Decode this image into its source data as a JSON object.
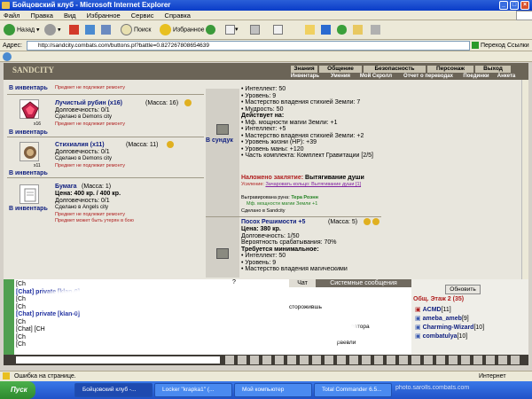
{
  "window": {
    "title": "Бойцовский клуб - Microsoft Internet Explorer"
  },
  "menu": [
    "Файл",
    "Правка",
    "Вид",
    "Избранное",
    "Сервис",
    "Справка"
  ],
  "toolbar": {
    "back": "Назад",
    "search": "Поиск",
    "favorites": "Избранное"
  },
  "address": {
    "label": "Адрес:",
    "url": "http://sandcity.combats.com/buttons.pl?battle=0.827267808654639",
    "go": "Переход",
    "links": "Ссылки"
  },
  "game": {
    "logo": "SANDCITY",
    "nav_top": [
      "Знания",
      "Общение",
      "Безопасность",
      "Персонаж",
      "Выход"
    ],
    "nav_bottom": [
      "Инвентарь",
      "Умения",
      "Мой Скролл",
      "Отчет о переводах",
      "Поединки",
      "Анкета"
    ]
  },
  "inventory": {
    "header_link": "В инвентарь",
    "header_note": "Предмет не подлежит ремонту",
    "items": [
      {
        "link": "В инвентарь",
        "name": "Лучистый рубин (x16)",
        "mass": "(Масса: 16)",
        "durability": "Долговечность: 0/1",
        "made": "Сделано в Demons city",
        "note": "Предмет не подлежит ремонту",
        "count": "x16"
      },
      {
        "link": "В инвентарь",
        "name": "Стихиалия (x11)",
        "mass": "(Масса: 11)",
        "durability": "Долговечность: 0/1",
        "made": "Сделано в Demons city",
        "note": "Предмет не подлежит ремонту",
        "count": "x11"
      },
      {
        "link": "В инвентарь",
        "name": "Бумага",
        "mass": "(Масса: 1)",
        "price": "Цена: 400 кр. / 400 кр.",
        "durability": "Долговечность: 0/1",
        "made": "Сделано в Angels city",
        "note": "Предмет не подлежит ремонту",
        "note2": "Предмет может быть утерян в бою"
      }
    ]
  },
  "chest": {
    "link": "В сундук",
    "item1": {
      "req": [
        "• Интеллект: 50",
        "• Уровень: 9",
        "• Мастерство владения стихией Земли: 7",
        "• Мудрость: 50"
      ],
      "acts": "Действует на:",
      "effects": [
        "• Мф. мощности магии Земли: +1",
        "• Интеллект: +5",
        "• Мастерство владения стихией Земли: +2",
        "• Уровень жизни (HP): +39",
        "• Уровень маны: +120",
        "• Часть комплекта: Комплект Гравитации [2/5]"
      ],
      "enchant_label": "Наложено заклятие:",
      "enchant": "Вытягивание души",
      "strength_label": "Усиление:",
      "strength": "Зачаровать кольцо: Вытягивание души [1]",
      "rune_label": "Выгравирована руна:",
      "rune": "Тера Роэнн",
      "rune_bonus": "Мф. мощности магии Земли +1",
      "made": "Сделано в Sandcity"
    },
    "item2": {
      "name": "Посох Решимости +5",
      "mass": "(Масса: 5)",
      "price": "Цена: 380 кр.",
      "durability": "Долговечность: 1/50",
      "prob": "Вероятность срабатывания: 70%",
      "req_title": "Требуется минимальное:",
      "req": [
        "• Интеллект: 50",
        "• Уровень: 9",
        "• Мастерство владения магическими"
      ]
    }
  },
  "chat": {
    "tab_chat": "Чат",
    "tab_sys": "Системные сообщения",
    "lines": [
      "[Ch",
      "[Chat] private [klan-0]",
      "[Ch",
      "[Ch",
      "[Chat] private [klan-0]",
      "[Ch",
      "[Chat] [CH",
      "[Ch",
      "[Ch"
    ],
    "frag": [
      "сторожившь",
      "?",
      "ватора",
      "рвевли"
    ]
  },
  "online": {
    "refresh": "Обновить",
    "title": "Общ. Этаж 2 (35)",
    "users": [
      {
        "name": "ACMD",
        "lvl": "[11]"
      },
      {
        "name": "ameba_ameb",
        "lvl": "[9]"
      },
      {
        "name": "Charming-Wizard",
        "lvl": "[10]"
      },
      {
        "name": "combatulya",
        "lvl": "[10]"
      }
    ]
  },
  "status": {
    "text": "Ошибка на странице.",
    "zone": "Интернет"
  },
  "taskbar": {
    "start": "Пуск",
    "tasks": [
      "Бойцовский клуб -...",
      "Locker \"krapka1\" (...",
      "Мой компьютер",
      "Total Commander 6.5..."
    ],
    "watermark": "photo.sarolls.combats.com"
  },
  "colors": {
    "title_bar": "#0a3cc8",
    "nav_bg": "#6b6457",
    "item_blue": "#102080",
    "note_red": "#b02020",
    "chat_bar": "#403c36"
  }
}
